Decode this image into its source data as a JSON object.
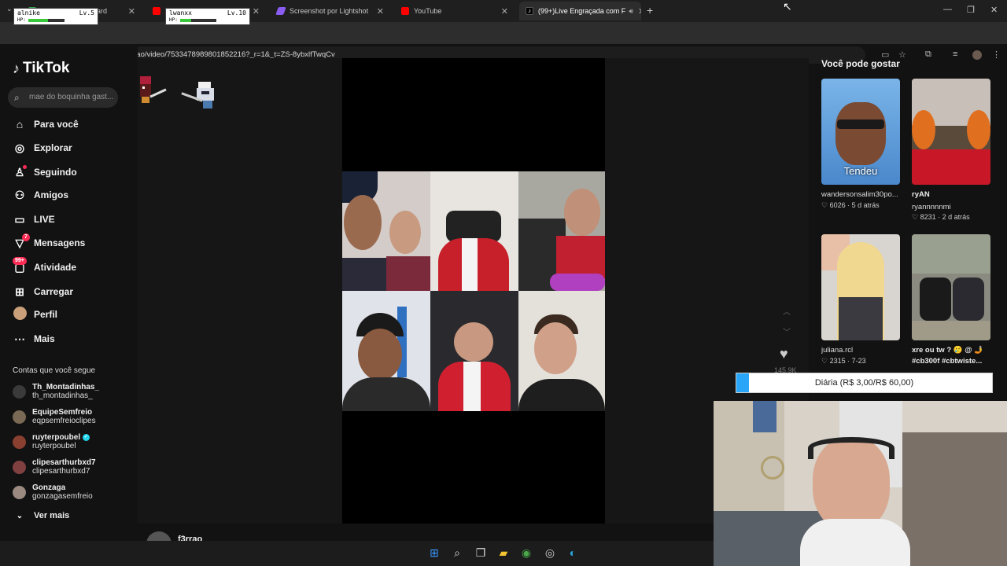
{
  "browser": {
    "tabs": [
      {
        "label": "Dashboard",
        "active": false
      },
      {
        "label": "",
        "active": false
      },
      {
        "label": "Screenshot por Lightshot",
        "active": false
      },
      {
        "label": "YouTube",
        "active": false
      },
      {
        "label": "(99+)Live Engraçada com F",
        "active": true
      }
    ],
    "url": "tiktok.com/@f3rrao/video/7533478989801852216?_r=1&_t=ZS-8ybxlfTwqCv"
  },
  "overlay": {
    "players": [
      {
        "name": "alnike",
        "level": "Lv.5",
        "hp_label": "HP:",
        "hp": 0.55
      },
      {
        "name": "lwanxx",
        "level": "Lv.10",
        "hp_label": "HP:",
        "hp": 0.3
      }
    ]
  },
  "tiktok": {
    "logo": "TikTok",
    "search_placeholder": "mae do boquinha gast...",
    "nav": [
      {
        "label": "Para você",
        "icon": "home-icon"
      },
      {
        "label": "Explorar",
        "icon": "compass-icon"
      },
      {
        "label": "Seguindo",
        "icon": "following-icon"
      },
      {
        "label": "Amigos",
        "icon": "friends-icon"
      },
      {
        "label": "LIVE",
        "icon": "live-icon"
      },
      {
        "label": "Mensagens",
        "icon": "messages-icon",
        "badge": "7"
      },
      {
        "label": "Atividade",
        "icon": "activity-icon",
        "badge": "99+"
      },
      {
        "label": "Carregar",
        "icon": "upload-icon"
      },
      {
        "label": "Perfil",
        "icon": "profile-avatar"
      },
      {
        "label": "Mais",
        "icon": "more-icon"
      }
    ],
    "following_header": "Contas que você segue",
    "following": [
      {
        "name": "Th_Montadinhas_",
        "handle": "th_montadinhas_",
        "color": "#3a3a3a"
      },
      {
        "name": "EquipeSemfreio",
        "handle": "eqpsemfreioclipes",
        "color": "#7a6a55"
      },
      {
        "name": "ruyterpoubel",
        "handle": "ruyterpoubel",
        "color": "#8a4030",
        "verified": true
      },
      {
        "name": "clipesarthurbxd7",
        "handle": "clipesarthurbxd7",
        "color": "#804040"
      },
      {
        "name": "Gonzaga",
        "handle": "gonzagasemfreio",
        "color": "#9a8a80"
      }
    ],
    "see_more": "Ver mais",
    "author": "f3rrao",
    "likes": "145.9K",
    "suggestions_title": "Você pode gostar",
    "suggestions": [
      {
        "title": "",
        "user": "wandersonsalim30po...",
        "likes": "6026",
        "time": "5 d atrás",
        "overlay": "Tendeu"
      },
      {
        "title": "ryAN",
        "user": "ryannnnnmi",
        "likes": "8231",
        "time": "2 d atrás",
        "overlay": ""
      },
      {
        "title": "",
        "user": "juliana.rcl",
        "likes": "2315",
        "time": "7-23",
        "overlay": ""
      },
      {
        "title": "xre ou tw ? 🥲 @ 🤳",
        "user": "#cb300f #cbtwiste...",
        "likes": "",
        "time": "",
        "overlay": ""
      }
    ]
  },
  "stream": {
    "donation_label": "Diária (R$ 3,00/R$ 60,00)",
    "donation_progress": 0.05
  },
  "colors": {
    "accent": "#fe2c55",
    "donation_fill": "#29a6f7"
  }
}
